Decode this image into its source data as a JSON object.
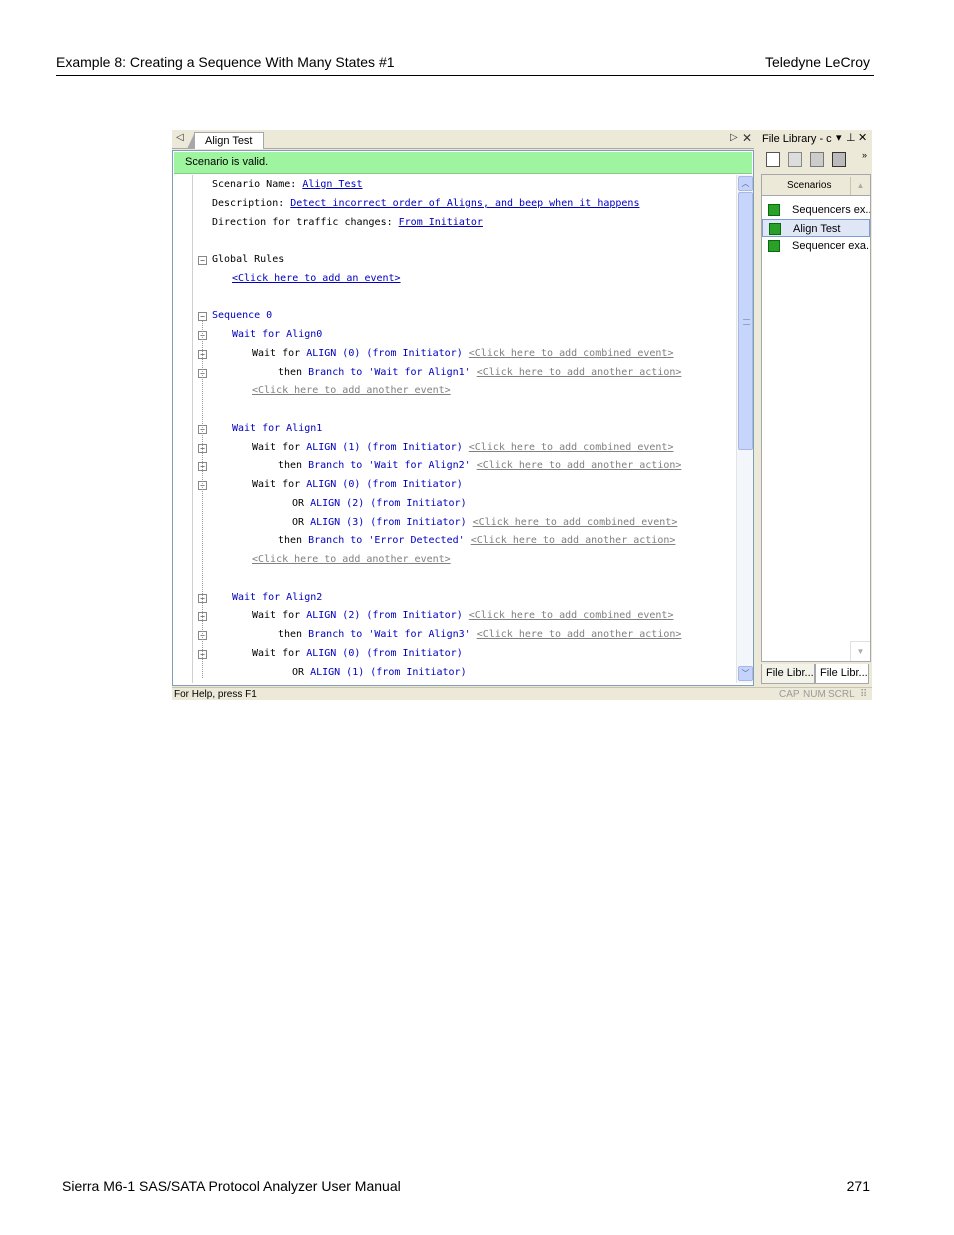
{
  "page": {
    "header_left": "Example 8: Creating a Sequence With Many States #1",
    "header_right": "Teledyne LeCroy",
    "footer_left": "Sierra M6-1 SAS/SATA Protocol Analyzer User Manual",
    "footer_right": "271"
  },
  "editor": {
    "tab_label": "Align Test",
    "status_message": "Scenario is valid.",
    "lines": [
      {
        "indent": 1,
        "parts": [
          {
            "t": "Scenario Name: ",
            "c": "kw"
          },
          {
            "t": "Align Test",
            "c": "link"
          }
        ]
      },
      {
        "indent": 1,
        "parts": [
          {
            "t": "Description: ",
            "c": "kw"
          },
          {
            "t": "Detect incorrect order of Aligns, and beep when it happens",
            "c": "link"
          }
        ]
      },
      {
        "indent": 1,
        "parts": [
          {
            "t": "Direction for traffic changes: ",
            "c": "kw"
          },
          {
            "t": "From Initiator",
            "c": "link"
          }
        ]
      },
      {
        "indent": 1,
        "parts": []
      },
      {
        "indent": 1,
        "parts": [
          {
            "t": "Global Rules",
            "c": "kw"
          }
        ]
      },
      {
        "indent": 2,
        "parts": [
          {
            "t": "<Click here to add an event>",
            "c": "link"
          }
        ]
      },
      {
        "indent": 1,
        "parts": []
      },
      {
        "indent": 1,
        "parts": [
          {
            "t": "Sequence 0",
            "c": "blue"
          }
        ]
      },
      {
        "indent": 2,
        "parts": [
          {
            "t": "Wait for Align0",
            "c": "blue"
          }
        ]
      },
      {
        "indent": 3,
        "parts": [
          {
            "t": "Wait for ",
            "c": "kw"
          },
          {
            "t": "ALIGN (0) (from Initiator)",
            "c": "blue"
          },
          {
            "t": " ",
            "c": "kw"
          },
          {
            "t": "<Click here to add combined event>",
            "c": "gray"
          }
        ]
      },
      {
        "indent": 4,
        "parts": [
          {
            "t": "then ",
            "c": "kw"
          },
          {
            "t": "Branch to 'Wait for Align1'",
            "c": "blue"
          },
          {
            "t": " ",
            "c": "kw"
          },
          {
            "t": "<Click here to add another action>",
            "c": "gray"
          }
        ]
      },
      {
        "indent": 3,
        "parts": [
          {
            "t": "<Click here to add another event>",
            "c": "gray"
          }
        ]
      },
      {
        "indent": 1,
        "parts": []
      },
      {
        "indent": 2,
        "parts": [
          {
            "t": "Wait for Align1",
            "c": "blue"
          }
        ]
      },
      {
        "indent": 3,
        "parts": [
          {
            "t": "Wait for ",
            "c": "kw"
          },
          {
            "t": "ALIGN (1) (from Initiator)",
            "c": "blue"
          },
          {
            "t": " ",
            "c": "kw"
          },
          {
            "t": "<Click here to add combined event>",
            "c": "gray"
          }
        ]
      },
      {
        "indent": 4,
        "parts": [
          {
            "t": "then ",
            "c": "kw"
          },
          {
            "t": "Branch to 'Wait for Align2'",
            "c": "blue"
          },
          {
            "t": " ",
            "c": "kw"
          },
          {
            "t": "<Click here to add another action>",
            "c": "gray"
          }
        ]
      },
      {
        "indent": 3,
        "parts": [
          {
            "t": "Wait for ",
            "c": "kw"
          },
          {
            "t": "ALIGN (0) (from Initiator)",
            "c": "blue"
          }
        ]
      },
      {
        "indent": 5,
        "parts": [
          {
            "t": "OR ",
            "c": "kw"
          },
          {
            "t": "ALIGN (2) (from Initiator)",
            "c": "blue"
          }
        ]
      },
      {
        "indent": 5,
        "parts": [
          {
            "t": "OR ",
            "c": "kw"
          },
          {
            "t": "ALIGN (3) (from Initiator)",
            "c": "blue"
          },
          {
            "t": " ",
            "c": "kw"
          },
          {
            "t": "<Click here to add combined event>",
            "c": "gray"
          }
        ]
      },
      {
        "indent": 4,
        "parts": [
          {
            "t": "then ",
            "c": "kw"
          },
          {
            "t": "Branch to 'Error Detected'",
            "c": "blue"
          },
          {
            "t": " ",
            "c": "kw"
          },
          {
            "t": "<Click here to add another action>",
            "c": "gray"
          }
        ]
      },
      {
        "indent": 3,
        "parts": [
          {
            "t": "<Click here to add another event>",
            "c": "gray"
          }
        ]
      },
      {
        "indent": 1,
        "parts": []
      },
      {
        "indent": 2,
        "parts": [
          {
            "t": "Wait for Align2",
            "c": "blue"
          }
        ]
      },
      {
        "indent": 3,
        "parts": [
          {
            "t": "Wait for ",
            "c": "kw"
          },
          {
            "t": "ALIGN (2) (from Initiator)",
            "c": "blue"
          },
          {
            "t": " ",
            "c": "kw"
          },
          {
            "t": "<Click here to add combined event>",
            "c": "gray"
          }
        ]
      },
      {
        "indent": 4,
        "parts": [
          {
            "t": "then ",
            "c": "kw"
          },
          {
            "t": "Branch to 'Wait for Align3'",
            "c": "blue"
          },
          {
            "t": " ",
            "c": "kw"
          },
          {
            "t": "<Click here to add another action>",
            "c": "gray"
          }
        ]
      },
      {
        "indent": 3,
        "parts": [
          {
            "t": "Wait for ",
            "c": "kw"
          },
          {
            "t": "ALIGN (0) (from Initiator)",
            "c": "blue"
          }
        ]
      },
      {
        "indent": 5,
        "parts": [
          {
            "t": "OR ",
            "c": "kw"
          },
          {
            "t": "ALIGN (1) (from Initiator)",
            "c": "blue"
          }
        ]
      }
    ]
  },
  "library": {
    "title": "File Library - c",
    "column_header": "Scenarios",
    "items": [
      {
        "label": "Sequencers ex...",
        "selected": false
      },
      {
        "label": "Align Test",
        "selected": true
      },
      {
        "label": "Sequencer exa...",
        "selected": false
      }
    ],
    "tabs": [
      "File Libr...",
      "File Libr..."
    ]
  },
  "statusbar": {
    "help": "For Help, press F1",
    "indicators": [
      "CAP",
      "NUM",
      "SCRL"
    ]
  },
  "colors": {
    "valid_bar": "#9ff59f",
    "link_blue": "#0000c0",
    "gray_link": "#808080"
  }
}
